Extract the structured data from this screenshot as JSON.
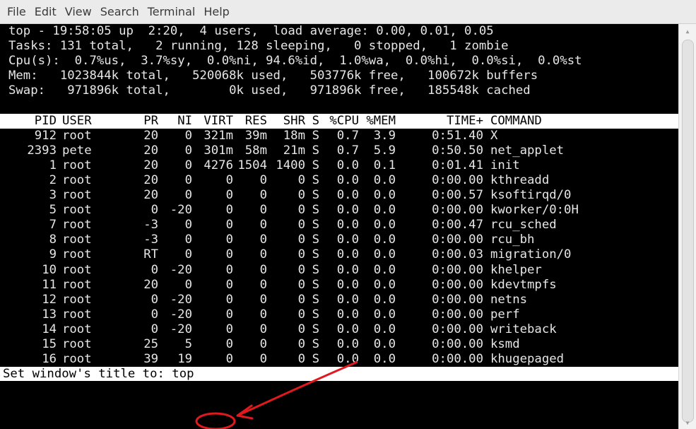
{
  "menubar": {
    "items": [
      "File",
      "Edit",
      "View",
      "Search",
      "Terminal",
      "Help"
    ]
  },
  "summary": {
    "line1": "top - 19:58:05 up  2:20,  4 users,  load average: 0.00, 0.01, 0.05",
    "line2": "Tasks: 131 total,   2 running, 128 sleeping,   0 stopped,   1 zombie",
    "line3": "Cpu(s):  0.7%us,  3.7%sy,  0.0%ni, 94.6%id,  1.0%wa,  0.0%hi,  0.0%si,  0.0%st",
    "line4": "Mem:   1023844k total,   520068k used,   503776k free,   100672k buffers",
    "line5": "Swap:   971896k total,        0k used,   971896k free,   185548k cached"
  },
  "table": {
    "headers": {
      "pid": "PID",
      "user": "USER",
      "pr": "PR",
      "ni": "NI",
      "virt": "VIRT",
      "res": "RES",
      "shr": "SHR",
      "s": "S",
      "cpu": "%CPU",
      "mem": "%MEM",
      "time": "TIME+",
      "command": "COMMAND"
    },
    "rows": [
      {
        "pid": "912",
        "user": "root",
        "pr": "20",
        "ni": "0",
        "virt": "321m",
        "res": "39m",
        "shr": "18m",
        "s": "S",
        "cpu": "0.7",
        "mem": "3.9",
        "time": "0:51.40",
        "command": "X"
      },
      {
        "pid": "2393",
        "user": "pete",
        "pr": "20",
        "ni": "0",
        "virt": "301m",
        "res": "58m",
        "shr": "21m",
        "s": "S",
        "cpu": "0.7",
        "mem": "5.9",
        "time": "0:50.50",
        "command": "net_applet"
      },
      {
        "pid": "1",
        "user": "root",
        "pr": "20",
        "ni": "0",
        "virt": "4276",
        "res": "1504",
        "shr": "1400",
        "s": "S",
        "cpu": "0.0",
        "mem": "0.1",
        "time": "0:01.41",
        "command": "init"
      },
      {
        "pid": "2",
        "user": "root",
        "pr": "20",
        "ni": "0",
        "virt": "0",
        "res": "0",
        "shr": "0",
        "s": "S",
        "cpu": "0.0",
        "mem": "0.0",
        "time": "0:00.00",
        "command": "kthreadd"
      },
      {
        "pid": "3",
        "user": "root",
        "pr": "20",
        "ni": "0",
        "virt": "0",
        "res": "0",
        "shr": "0",
        "s": "S",
        "cpu": "0.0",
        "mem": "0.0",
        "time": "0:00.57",
        "command": "ksoftirqd/0"
      },
      {
        "pid": "5",
        "user": "root",
        "pr": "0",
        "ni": "-20",
        "virt": "0",
        "res": "0",
        "shr": "0",
        "s": "S",
        "cpu": "0.0",
        "mem": "0.0",
        "time": "0:00.00",
        "command": "kworker/0:0H"
      },
      {
        "pid": "7",
        "user": "root",
        "pr": "-3",
        "ni": "0",
        "virt": "0",
        "res": "0",
        "shr": "0",
        "s": "S",
        "cpu": "0.0",
        "mem": "0.0",
        "time": "0:00.47",
        "command": "rcu_sched"
      },
      {
        "pid": "8",
        "user": "root",
        "pr": "-3",
        "ni": "0",
        "virt": "0",
        "res": "0",
        "shr": "0",
        "s": "S",
        "cpu": "0.0",
        "mem": "0.0",
        "time": "0:00.00",
        "command": "rcu_bh"
      },
      {
        "pid": "9",
        "user": "root",
        "pr": "RT",
        "ni": "0",
        "virt": "0",
        "res": "0",
        "shr": "0",
        "s": "S",
        "cpu": "0.0",
        "mem": "0.0",
        "time": "0:00.03",
        "command": "migration/0"
      },
      {
        "pid": "10",
        "user": "root",
        "pr": "0",
        "ni": "-20",
        "virt": "0",
        "res": "0",
        "shr": "0",
        "s": "S",
        "cpu": "0.0",
        "mem": "0.0",
        "time": "0:00.00",
        "command": "khelper"
      },
      {
        "pid": "11",
        "user": "root",
        "pr": "20",
        "ni": "0",
        "virt": "0",
        "res": "0",
        "shr": "0",
        "s": "S",
        "cpu": "0.0",
        "mem": "0.0",
        "time": "0:00.00",
        "command": "kdevtmpfs"
      },
      {
        "pid": "12",
        "user": "root",
        "pr": "0",
        "ni": "-20",
        "virt": "0",
        "res": "0",
        "shr": "0",
        "s": "S",
        "cpu": "0.0",
        "mem": "0.0",
        "time": "0:00.00",
        "command": "netns"
      },
      {
        "pid": "13",
        "user": "root",
        "pr": "0",
        "ni": "-20",
        "virt": "0",
        "res": "0",
        "shr": "0",
        "s": "S",
        "cpu": "0.0",
        "mem": "0.0",
        "time": "0:00.00",
        "command": "perf"
      },
      {
        "pid": "14",
        "user": "root",
        "pr": "0",
        "ni": "-20",
        "virt": "0",
        "res": "0",
        "shr": "0",
        "s": "S",
        "cpu": "0.0",
        "mem": "0.0",
        "time": "0:00.00",
        "command": "writeback"
      },
      {
        "pid": "15",
        "user": "root",
        "pr": "25",
        "ni": "5",
        "virt": "0",
        "res": "0",
        "shr": "0",
        "s": "S",
        "cpu": "0.0",
        "mem": "0.0",
        "time": "0:00.00",
        "command": "ksmd"
      },
      {
        "pid": "16",
        "user": "root",
        "pr": "39",
        "ni": "19",
        "virt": "0",
        "res": "0",
        "shr": "0",
        "s": "S",
        "cpu": "0.0",
        "mem": "0.0",
        "time": "0:00.00",
        "command": "khugepaged"
      }
    ]
  },
  "prompt": {
    "label": "Set window's title to: ",
    "value": "top"
  },
  "colors": {
    "terminal_bg": "#000000",
    "terminal_fg": "#e6e6e6",
    "header_bg": "#ffffff",
    "annotation": "#e0191f"
  },
  "icons": {
    "scroll_up": "scroll-up-arrow-icon",
    "scroll_down": "scroll-down-arrow-icon"
  }
}
